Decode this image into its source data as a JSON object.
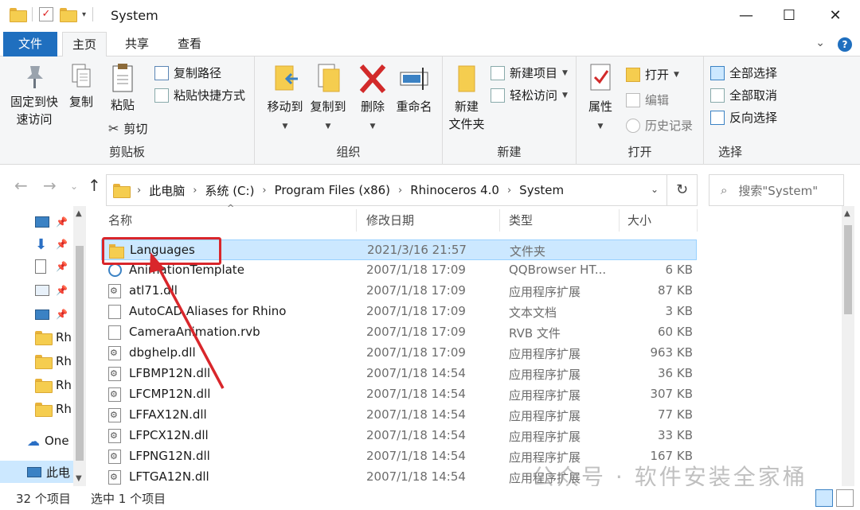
{
  "window": {
    "title": "System",
    "minimize": "—",
    "maximize": "☐",
    "close": "✕"
  },
  "tabs": [
    {
      "label": "文件"
    },
    {
      "label": "主页"
    },
    {
      "label": "共享"
    },
    {
      "label": "查看"
    }
  ],
  "help_icon": "?",
  "ribbon": {
    "clipboard": {
      "label": "剪贴板",
      "pin_quick_access": "固定到快\n速访问",
      "pin_line1": "固定到快",
      "pin_line2": "速访问",
      "copy": "复制",
      "paste": "粘贴",
      "copy_path": "复制路径",
      "paste_shortcut": "粘贴快捷方式",
      "cut": "剪切"
    },
    "organize": {
      "label": "组织",
      "move_to": "移动到",
      "copy_to": "复制到",
      "delete": "删除",
      "rename": "重命名"
    },
    "new": {
      "label": "新建",
      "new_folder_line1": "新建",
      "new_folder_line2": "文件夹",
      "new_item": "新建项目",
      "easy_access": "轻松访问"
    },
    "open": {
      "label": "打开",
      "properties": "属性",
      "open": "打开",
      "edit": "编辑",
      "history": "历史记录"
    },
    "select": {
      "label": "选择",
      "select_all": "全部选择",
      "select_none": "全部取消",
      "invert": "反向选择"
    }
  },
  "address": {
    "crumbs": [
      "此电脑",
      "系统 (C:)",
      "Program Files (x86)",
      "Rhinoceros 4.0",
      "System"
    ],
    "search_placeholder": "搜索\"System\""
  },
  "navpane": {
    "items": [
      {
        "label": "Rh"
      },
      {
        "label": "Rh"
      },
      {
        "label": "Rh"
      },
      {
        "label": "Rh"
      },
      {
        "label": "One"
      },
      {
        "label": "此电"
      }
    ]
  },
  "columns": {
    "name": "名称",
    "date": "修改日期",
    "type": "类型",
    "size": "大小"
  },
  "files": [
    {
      "name": "Languages",
      "date": "2021/3/16 21:57",
      "type": "文件夹",
      "size": "",
      "icon": "folder-icon",
      "selected": true
    },
    {
      "name": "AnimationTemplate",
      "date": "2007/1/18 17:09",
      "type": "QQBrowser HT...",
      "size": "6 KB",
      "icon": "html-icon"
    },
    {
      "name": "atl71.dll",
      "date": "2007/1/18 17:09",
      "type": "应用程序扩展",
      "size": "87 KB",
      "icon": "dll-icon"
    },
    {
      "name": "AutoCAD Aliases for Rhino",
      "date": "2007/1/18 17:09",
      "type": "文本文档",
      "size": "3 KB",
      "icon": "file-icon"
    },
    {
      "name": "CameraAnimation.rvb",
      "date": "2007/1/18 17:09",
      "type": "RVB 文件",
      "size": "60 KB",
      "icon": "file-icon"
    },
    {
      "name": "dbghelp.dll",
      "date": "2007/1/18 17:09",
      "type": "应用程序扩展",
      "size": "963 KB",
      "icon": "dll-icon"
    },
    {
      "name": "LFBMP12N.dll",
      "date": "2007/1/18 14:54",
      "type": "应用程序扩展",
      "size": "36 KB",
      "icon": "dll-icon"
    },
    {
      "name": "LFCMP12N.dll",
      "date": "2007/1/18 14:54",
      "type": "应用程序扩展",
      "size": "307 KB",
      "icon": "dll-icon"
    },
    {
      "name": "LFFAX12N.dll",
      "date": "2007/1/18 14:54",
      "type": "应用程序扩展",
      "size": "77 KB",
      "icon": "dll-icon"
    },
    {
      "name": "LFPCX12N.dll",
      "date": "2007/1/18 14:54",
      "type": "应用程序扩展",
      "size": "33 KB",
      "icon": "dll-icon"
    },
    {
      "name": "LFPNG12N.dll",
      "date": "2007/1/18 14:54",
      "type": "应用程序扩展",
      "size": "167 KB",
      "icon": "dll-icon"
    },
    {
      "name": "LFTGA12N.dll",
      "date": "2007/1/18 14:54",
      "type": "应用程序扩展",
      "size": "",
      "icon": "dll-icon"
    }
  ],
  "status": {
    "count": "32 个项目",
    "selected": "选中 1 个项目"
  },
  "watermark": "公众号 · 软件安装全家桶",
  "colors": {
    "accent": "#1f6fbf",
    "selection": "#cce8ff",
    "annotation": "#d9262b"
  }
}
